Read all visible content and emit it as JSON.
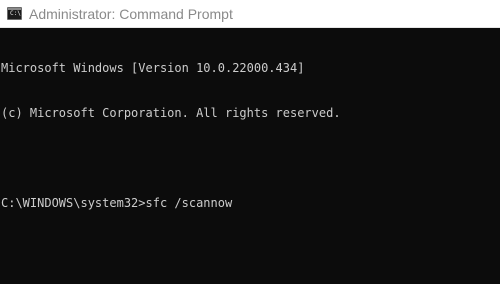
{
  "window": {
    "title": "Administrator: Command Prompt",
    "icon": "cmd-icon",
    "icon_glyph": "C:\\"
  },
  "console": {
    "lines": [
      "Microsoft Windows [Version 10.0.22000.434]",
      "(c) Microsoft Corporation. All rights reserved.",
      ""
    ],
    "prompt": "C:\\WINDOWS\\system32>",
    "command": "sfc /scannow"
  },
  "colors": {
    "background": "#0c0c0c",
    "text": "#cccccc",
    "titlebar": "#ffffff",
    "title_text": "#8a8a8a"
  }
}
